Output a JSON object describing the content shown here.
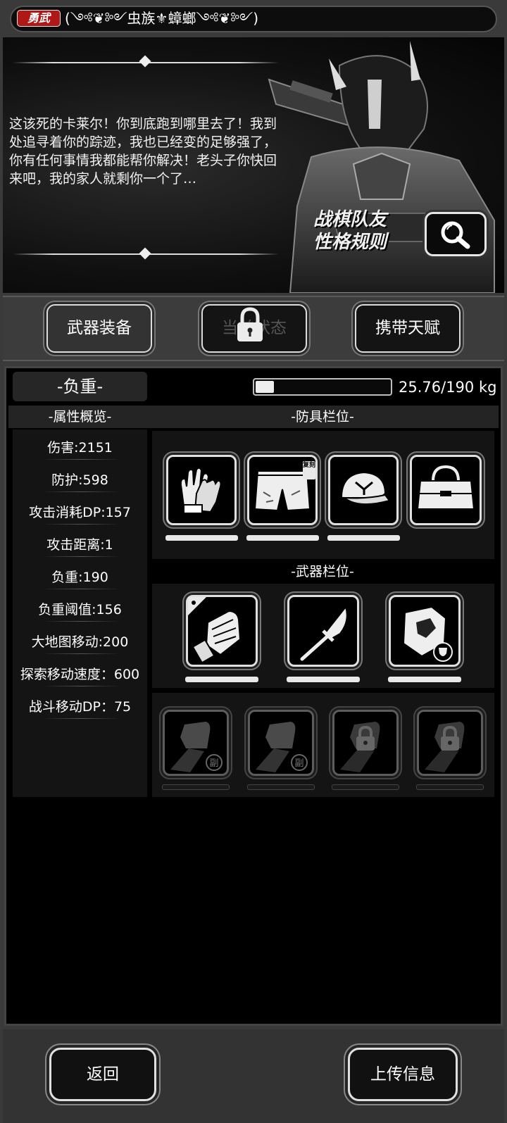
{
  "header": {
    "rank_badge": "勇武",
    "title": "(༺❦༻虫族⚜蟑螂༺❦༻)"
  },
  "story": {
    "text": "这该死的卡莱尔！你到底跑到哪里去了！我到处追寻着你的踪迹，我也已经变的足够强了，你有任何事情我都能帮你解决！老头子你快回来吧，我的家人就剩你一个了…",
    "tip_label_line1": "战棋队友",
    "tip_label_line2": "性格规则",
    "search_icon": "magnifier-icon"
  },
  "tabs": [
    {
      "label": "武器装备",
      "state": "active"
    },
    {
      "label": "当前状态",
      "state": "locked"
    },
    {
      "label": "携带天赋",
      "state": "normal"
    }
  ],
  "load": {
    "label": "-负重-",
    "current": 25.76,
    "max": 190,
    "unit": "kg",
    "display": "25.76/190 kg"
  },
  "attributes": {
    "title": "-属性概览-",
    "items": [
      "伤害:2151",
      "防护:598",
      "攻击消耗DP:157",
      "攻击距离:1",
      "负重:190",
      "负重阈值:156",
      "大地图移动:200",
      "探索移动速度：600",
      "战斗移动DP：75"
    ]
  },
  "armor": {
    "title": "-防具栏位-",
    "slots": [
      {
        "icon": "gloves-icon",
        "badge": ""
      },
      {
        "icon": "shorts-icon",
        "badge": "复刻"
      },
      {
        "icon": "cap-icon",
        "badge": ""
      },
      {
        "icon": "bag-icon",
        "badge": ""
      }
    ]
  },
  "weapons": {
    "title": "-武器栏位-",
    "slots": [
      {
        "icon": "power-fist-icon"
      },
      {
        "icon": "blade-icon"
      },
      {
        "icon": "shield-gauntlet-icon"
      }
    ],
    "offhand": [
      {
        "icon": "fist-icon",
        "mark": "副"
      },
      {
        "icon": "fist-icon",
        "mark": "副"
      },
      {
        "icon": "locked-icon"
      },
      {
        "icon": "locked-icon"
      }
    ]
  },
  "footer": {
    "back_label": "返回",
    "upload_label": "上传信息"
  }
}
